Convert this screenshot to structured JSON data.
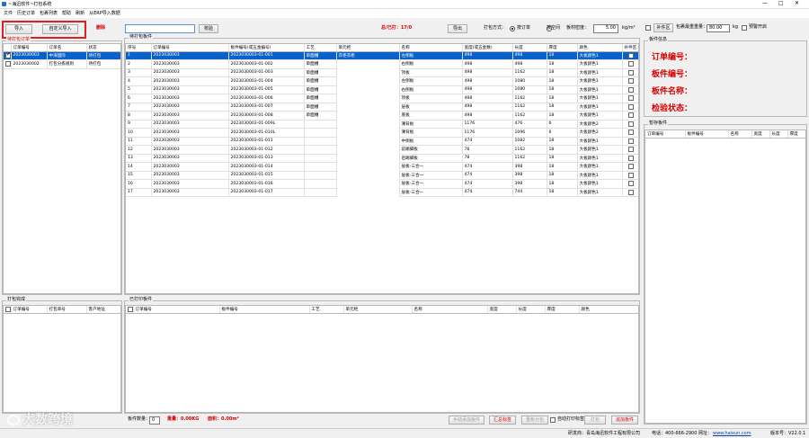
{
  "window": {
    "title": "~海迅软件~打包系统"
  },
  "menu": [
    {
      "label": "文件"
    },
    {
      "label": "历史订单"
    },
    {
      "label": "包裹列表"
    },
    {
      "label": "帮助"
    },
    {
      "label": "刷新"
    },
    {
      "label": "从ERP导入数据"
    }
  ],
  "left": {
    "import_label": "导入",
    "custom_import_label": "自定义导入",
    "delete_label": "删除",
    "section_label": "待打包订单",
    "orders_headers": [
      "订单编号",
      "订单名",
      "状态"
    ],
    "orders": [
      {
        "id": "2023030003",
        "name": "中海国际",
        "status": "待打包",
        "selected": true
      },
      {
        "id": "2023030002",
        "name": "打包分拣规则",
        "status": "待打包",
        "selected": false
      }
    ],
    "packed_label": "打包完成",
    "packed_headers": [
      "订单编号",
      "打包单号",
      "客户地址"
    ]
  },
  "center": {
    "search_value": "",
    "verify_label": "校验",
    "totals": "总/已打：17/0",
    "export_label": "导出",
    "pack_mode_label": "打包方式：",
    "mode_order_label": "按订单",
    "mode_space_label": "按空间",
    "mode_selected": "order",
    "density_label": "板材密度：",
    "density_value": "5.00",
    "density_unit": "kg/m²",
    "pending_label": "待打包板件",
    "pending_headers": [
      "序号",
      "订单编号",
      "板件编号(或五金编号)",
      "工艺",
      "单元柜",
      "名称",
      "宽度(或五金数)",
      "长度",
      "厚度",
      "颜色",
      "补件区"
    ],
    "cabinet": "衣柜衣柜",
    "parts": [
      {
        "no": "1",
        "order": "2023030003",
        "code": "2023030003-01-001",
        "proc": "单面槽",
        "name": "左侧板",
        "w": "498",
        "l": "498",
        "t": "18",
        "color": "大板颜色1",
        "sel": true
      },
      {
        "no": "2",
        "order": "2023030003",
        "code": "2023030003-01-002",
        "proc": "单面槽",
        "name": "右侧板",
        "w": "498",
        "l": "498",
        "t": "18",
        "color": "大板颜色1",
        "sel": false
      },
      {
        "no": "3",
        "order": "2023030003",
        "code": "2023030003-01-003",
        "proc": "单面槽",
        "name": "顶板",
        "w": "498",
        "l": "1162",
        "t": "18",
        "color": "大板颜色1",
        "sel": false
      },
      {
        "no": "4",
        "order": "2023030003",
        "code": "2023030003-01-004",
        "proc": "单面槽",
        "name": "左侧板",
        "w": "498",
        "l": "1080",
        "t": "18",
        "color": "大板颜色1",
        "sel": false
      },
      {
        "no": "5",
        "order": "2023030003",
        "code": "2023030003-01-005",
        "proc": "单面槽",
        "name": "右侧板",
        "w": "498",
        "l": "1080",
        "t": "18",
        "color": "大板颜色1",
        "sel": false
      },
      {
        "no": "6",
        "order": "2023030003",
        "code": "2023030003-01-006",
        "proc": "单面槽",
        "name": "顶板",
        "w": "498",
        "l": "1162",
        "t": "18",
        "color": "大板颜色1",
        "sel": false
      },
      {
        "no": "7",
        "order": "2023030003",
        "code": "2023030003-01-007",
        "proc": "单面槽",
        "name": "层板",
        "w": "498",
        "l": "1162",
        "t": "18",
        "color": "大板颜色1",
        "sel": false
      },
      {
        "no": "8",
        "order": "2023030003",
        "code": "2023030003-01-008",
        "proc": "单面槽",
        "name": "底板",
        "w": "498",
        "l": "1162",
        "t": "18",
        "color": "大板颜色1",
        "sel": false
      },
      {
        "no": "9",
        "order": "2023030003",
        "code": "2023030003-01-009L",
        "proc": "",
        "name": "薄背板",
        "w": "1176",
        "l": "476",
        "t": "6",
        "color": "大板颜色2",
        "sel": false
      },
      {
        "no": "10",
        "order": "2023030003",
        "code": "2023030003-01-010L",
        "proc": "",
        "name": "薄背板",
        "w": "1176",
        "l": "1096",
        "t": "6",
        "color": "大板颜色2",
        "sel": false
      },
      {
        "no": "11",
        "order": "2023030003",
        "code": "2023030003-01-011",
        "proc": "",
        "name": "中侧板",
        "w": "474",
        "l": "1082",
        "t": "18",
        "color": "大板颜色1",
        "sel": false
      },
      {
        "no": "12",
        "order": "2023030003",
        "code": "2023030003-01-012",
        "proc": "",
        "name": "前踢脚板",
        "w": "78",
        "l": "1162",
        "t": "18",
        "color": "大板颜色1",
        "sel": false
      },
      {
        "no": "13",
        "order": "2023030003",
        "code": "2023030003-01-013",
        "proc": "",
        "name": "后踢脚板",
        "w": "78",
        "l": "1162",
        "t": "18",
        "color": "大板颜色1",
        "sel": false
      },
      {
        "no": "14",
        "order": "2023030003",
        "code": "2023030003-01-014",
        "proc": "",
        "name": "层板-三合一",
        "w": "474",
        "l": "398",
        "t": "18",
        "color": "大板颜色1",
        "sel": false
      },
      {
        "no": "15",
        "order": "2023030003",
        "code": "2023030003-01-015",
        "proc": "",
        "name": "层板-三合一",
        "w": "474",
        "l": "398",
        "t": "18",
        "color": "大板颜色1",
        "sel": false
      },
      {
        "no": "16",
        "order": "2023030003",
        "code": "2023030003-01-016",
        "proc": "",
        "name": "层板-三合一",
        "w": "474",
        "l": "398",
        "t": "18",
        "color": "大板颜色1",
        "sel": false
      },
      {
        "no": "17",
        "order": "2023030003",
        "code": "2023030003-01-017",
        "proc": "",
        "name": "层板-三合一",
        "w": "474",
        "l": "744",
        "t": "18",
        "color": "大板颜色1",
        "sel": false
      }
    ],
    "packed_label": "已打印板件",
    "packed_headers": [
      "订单编号",
      "板件编号",
      "工艺",
      "单元柜",
      "名称",
      "宽度",
      "长度",
      "厚度",
      "颜色"
    ]
  },
  "bottom": {
    "count_label": "板件数量：",
    "count_value": "0",
    "weight": "重量：0.00KG",
    "area": "面积：0.00m²",
    "btn_manual": "手动添加板件",
    "btn_summary": "汇总标签",
    "btn_merge": "重新分包",
    "auto_print_label": "自动打印标签",
    "btn_pack": "打包",
    "btn_add": "追加板件"
  },
  "right": {
    "patch_label": "补件区",
    "max_weight_label": "包裹最重重量：",
    "max_weight_value": "80.00",
    "weight_unit": "kg",
    "pre_open_label": "预警开启",
    "info_label": "板件信息",
    "order_no": "订单编号：",
    "part_no": "板件编号：",
    "part_name": "板件名称：",
    "check_status": "检验状态：",
    "storage_label": "暂存板件",
    "storage_headers": [
      "订单编号",
      "板件编号",
      "名称",
      "宽度",
      "长度",
      "厚度"
    ]
  },
  "status": {
    "dev": "研发商：青岛海迅软件工程有限公司",
    "phone": "电话：400-666-2900",
    "website_label": "网址：",
    "website": "www.haixun.com",
    "version": "版本号：V22.0.1"
  },
  "watermark": "大数跨境"
}
